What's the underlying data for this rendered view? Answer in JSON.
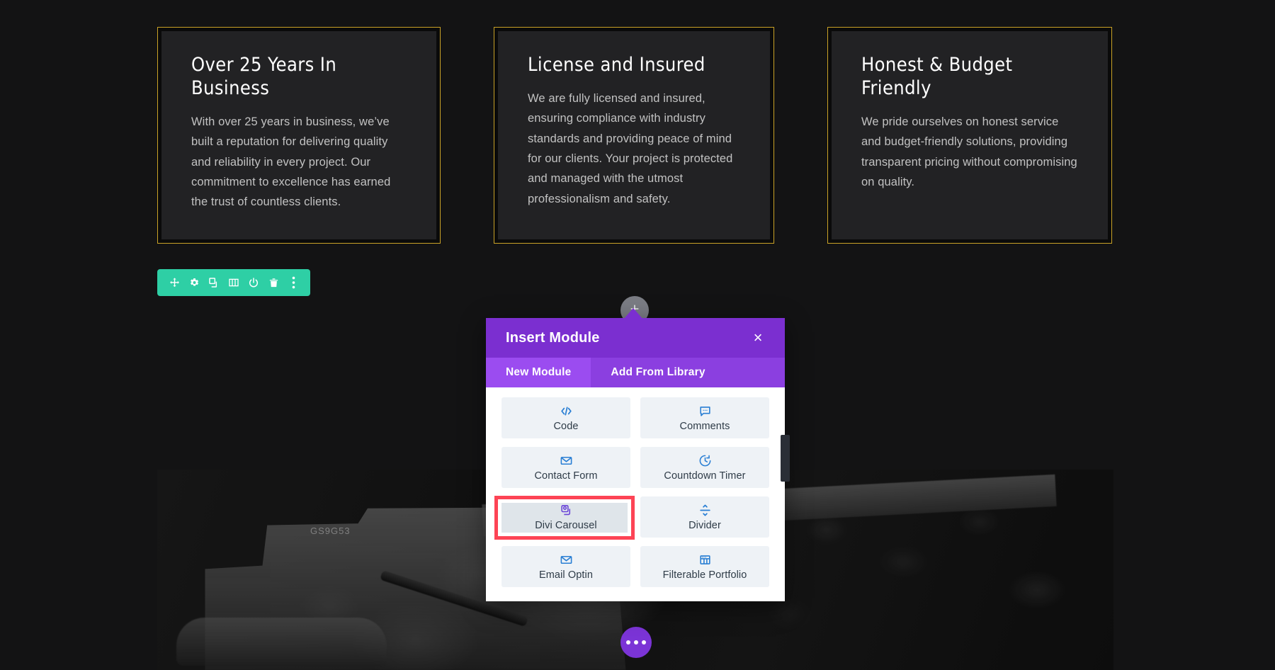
{
  "page": {
    "cards": [
      {
        "title": "Over 25 Years In Business",
        "body": "With over 25 years in business, we’ve built a reputation for delivering quality and reliability in every project. Our commitment to excellence has earned the trust of countless clients."
      },
      {
        "title": "License and Insured",
        "body": "We are fully licensed and insured, ensuring compliance with industry standards and providing peace of mind for our clients. Your project is protected and managed with the utmost professionalism and safety."
      },
      {
        "title": "Honest & Budget Friendly",
        "body": "We pride ourselves on honest service and budget-friendly solutions, providing transparent pricing without compromising on quality."
      }
    ],
    "background_photo_caption": "GS9G53"
  },
  "module_toolbar": {
    "items": [
      {
        "icon": "move-icon",
        "label": "Move Module"
      },
      {
        "icon": "gear-icon",
        "label": "Module Settings"
      },
      {
        "icon": "duplicate-icon",
        "label": "Duplicate Module"
      },
      {
        "icon": "columns-icon",
        "label": "Change Column Structure"
      },
      {
        "icon": "power-icon",
        "label": "Disable Module"
      },
      {
        "icon": "trash-icon",
        "label": "Delete Module"
      },
      {
        "icon": "kebab-menu-icon",
        "label": "More Options"
      }
    ]
  },
  "add_button": {
    "icon": "plus-icon",
    "label": "Add New Module"
  },
  "options_button": {
    "icon": "ellipsis-icon",
    "label": "Page Settings"
  },
  "modal": {
    "title": "Insert Module",
    "close_label": "×",
    "close_icon": "close-icon",
    "tabs": [
      {
        "label": "New Module",
        "active": true
      },
      {
        "label": "Add From Library",
        "active": false
      }
    ],
    "modules": [
      {
        "label": "Code",
        "icon": "code-icon",
        "highlighted": false
      },
      {
        "label": "Comments",
        "icon": "comment-icon",
        "highlighted": false
      },
      {
        "label": "Contact Form",
        "icon": "envelope-icon",
        "highlighted": false
      },
      {
        "label": "Countdown Timer",
        "icon": "clock-icon",
        "highlighted": false
      },
      {
        "label": "Divi Carousel",
        "icon": "carousel-icon",
        "highlighted": true
      },
      {
        "label": "Divider",
        "icon": "divider-icon",
        "highlighted": false
      },
      {
        "label": "Email Optin",
        "icon": "envelope-icon",
        "highlighted": false
      },
      {
        "label": "Filterable Portfolio",
        "icon": "grid-icon",
        "highlighted": false
      }
    ]
  },
  "colors": {
    "card_border": "#c9a227",
    "card_background": "#222224",
    "page_background": "#131314",
    "toolbar_green": "#2ecfa5",
    "modal_header_purple": "#7b2fd0",
    "modal_tab_active": "#9b4cf0",
    "modal_tab_inactive": "#8b3fe0",
    "tile_background": "#eef2f6",
    "tile_icon_blue": "#2a7fd4",
    "carousel_icon_purple": "#6a45d8",
    "highlight_ring_red": "#fd4455",
    "options_button_purple": "#7b34d6",
    "add_button_gray": "#7b7d85"
  }
}
